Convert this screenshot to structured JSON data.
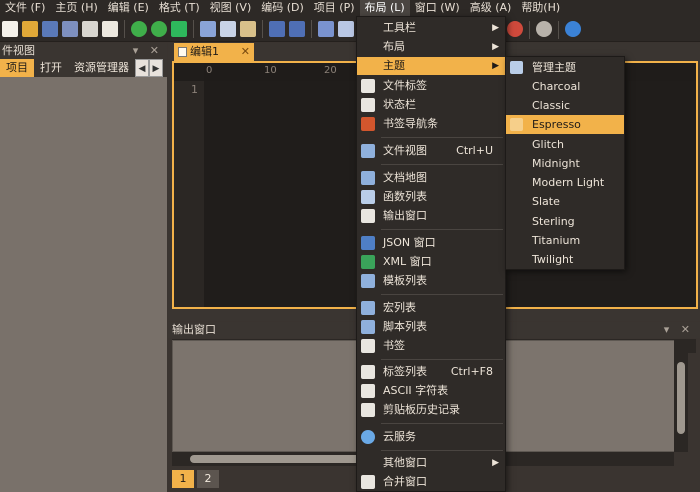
{
  "menubar": [
    {
      "label": "文件 (F)"
    },
    {
      "label": "主页 (H)"
    },
    {
      "label": "编辑 (E)"
    },
    {
      "label": "格式 (T)"
    },
    {
      "label": "视图 (V)"
    },
    {
      "label": "编码 (D)"
    },
    {
      "label": "项目 (P)"
    },
    {
      "label": "布局 (L)"
    },
    {
      "label": "窗口 (W)"
    },
    {
      "label": "高级 (A)"
    },
    {
      "label": "帮助(H)"
    }
  ],
  "left_panel": {
    "title": "件视图",
    "controls": "▾ ✕",
    "tabs": [
      "项目",
      "打开",
      "资源管理器"
    ],
    "arrow_left": "◀",
    "arrow_right": "▶"
  },
  "editor": {
    "tab_label": "编辑1",
    "tab_close": "✕",
    "ruler": [
      "0",
      "10",
      "20"
    ],
    "line_numbers": [
      "1"
    ]
  },
  "output": {
    "title": "输出窗口",
    "controls": "▾ ✕",
    "pages": [
      "1",
      "2"
    ]
  },
  "layout_menu": {
    "items": [
      {
        "label": "工具栏",
        "submenu": "▶"
      },
      {
        "label": "布局",
        "submenu": "▶"
      },
      {
        "label": "主题",
        "submenu": "▶"
      },
      {
        "label": "文件标签"
      },
      {
        "label": "状态栏"
      },
      {
        "label": "书签导航条"
      },
      {
        "label": "文件视图",
        "shortcut": "Ctrl+U"
      },
      {
        "label": "文档地图"
      },
      {
        "label": "函数列表"
      },
      {
        "label": "输出窗口"
      },
      {
        "label": "JSON 窗口"
      },
      {
        "label": "XML 窗口"
      },
      {
        "label": "模板列表"
      },
      {
        "label": "宏列表"
      },
      {
        "label": "脚本列表"
      },
      {
        "label": "书签"
      },
      {
        "label": "标签列表",
        "shortcut": "Ctrl+F8"
      },
      {
        "label": "ASCII 字符表"
      },
      {
        "label": "剪贴板历史记录"
      },
      {
        "label": "云服务"
      },
      {
        "label": "其他窗口",
        "submenu": "▶"
      },
      {
        "label": "合并窗口"
      }
    ]
  },
  "theme_menu": {
    "items": [
      "管理主题",
      "Charcoal",
      "Classic",
      "Espresso",
      "Glitch",
      "Midnight",
      "Modern Light",
      "Slate",
      "Sterling",
      "Titanium",
      "Twilight"
    ],
    "selected": "Espresso"
  },
  "colors": {
    "accent": "#f2b24a",
    "background": "#3a3430",
    "menu": "#2f2b28"
  }
}
